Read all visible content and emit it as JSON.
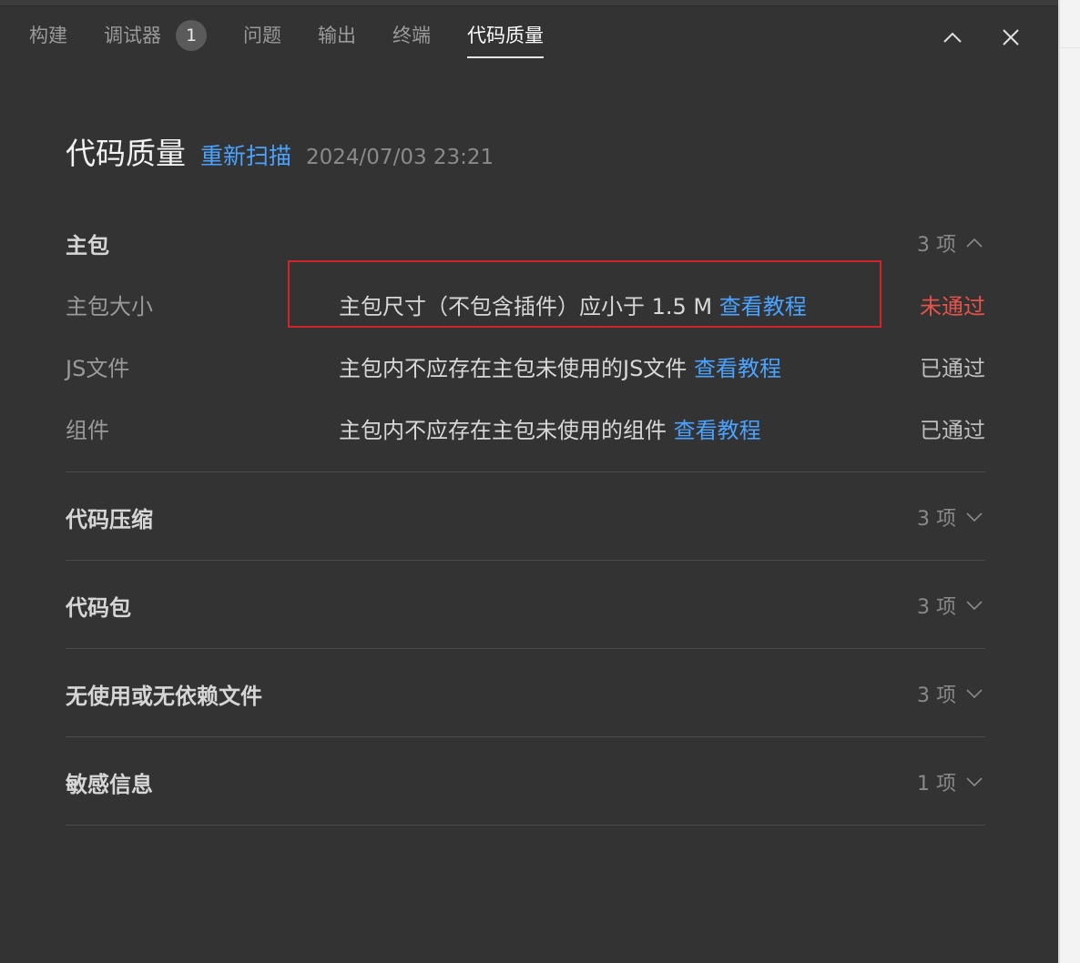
{
  "tabs": [
    {
      "label": "构建"
    },
    {
      "label": "调试器",
      "badge": "1"
    },
    {
      "label": "问题"
    },
    {
      "label": "输出"
    },
    {
      "label": "终端"
    },
    {
      "label": "代码质量",
      "active": true
    }
  ],
  "header": {
    "title": "代码质量",
    "rescan_label": "重新扫描",
    "timestamp": "2024/07/03 23:21"
  },
  "sections": [
    {
      "title": "主包",
      "count": "3 项",
      "expanded": true,
      "items": [
        {
          "label": "主包大小",
          "desc": "主包尺寸（不包含插件）应小于 1.5 M",
          "link": "查看教程",
          "status": "未通过",
          "failed": true
        },
        {
          "label": "JS文件",
          "desc": "主包内不应存在主包未使用的JS文件",
          "link": "查看教程",
          "status": "已通过",
          "failed": false
        },
        {
          "label": "组件",
          "desc": "主包内不应存在主包未使用的组件",
          "link": "查看教程",
          "status": "已通过",
          "failed": false
        }
      ]
    },
    {
      "title": "代码压缩",
      "count": "3 项",
      "expanded": false
    },
    {
      "title": "代码包",
      "count": "3 项",
      "expanded": false
    },
    {
      "title": "无使用或无依赖文件",
      "count": "3 项",
      "expanded": false
    },
    {
      "title": "敏感信息",
      "count": "1 项",
      "expanded": false
    }
  ],
  "colors": {
    "panel_bg": "#333333",
    "link": "#4aa3ff",
    "fail": "#e5534b",
    "highlight": "#d4242b"
  },
  "icons": {
    "collapse_panel": "chevron-up-icon",
    "close_panel": "close-icon",
    "section_expanded": "chevron-up-icon",
    "section_collapsed": "chevron-down-icon"
  }
}
